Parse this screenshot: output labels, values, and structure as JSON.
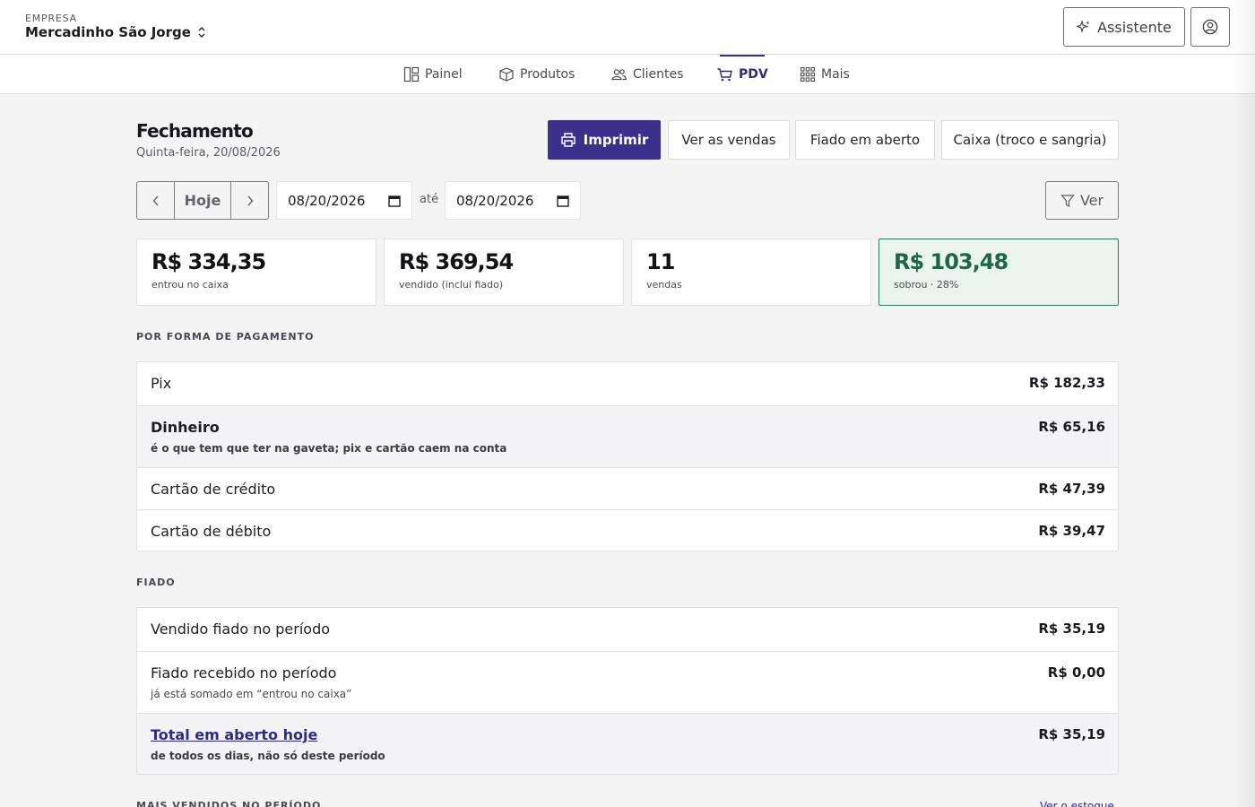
{
  "header": {
    "company_label": "EMPRESA",
    "company_name": "Mercadinho São Jorge",
    "assistant_label": "Assistente"
  },
  "nav": {
    "items": [
      {
        "label": "Painel",
        "icon": "layout-icon"
      },
      {
        "label": "Produtos",
        "icon": "box-icon"
      },
      {
        "label": "Clientes",
        "icon": "users-icon"
      },
      {
        "label": "PDV",
        "icon": "cart-icon",
        "active": true
      },
      {
        "label": "Mais",
        "icon": "grid-icon"
      }
    ]
  },
  "page": {
    "title": "Fechamento",
    "date": "Quinta-feira, 20/08/2026"
  },
  "actions": {
    "print": "Imprimir",
    "view_sales": "Ver as vendas",
    "open_credit": "Fiado em aberto",
    "cashbox": "Caixa (troco e sangria)"
  },
  "filters": {
    "today": "Hoje",
    "date_from": "08/20/2026",
    "until": "até",
    "date_to": "08/20/2026",
    "view": "Ver"
  },
  "stats": [
    {
      "value": "R$ 334,35",
      "label": "entrou no caixa"
    },
    {
      "value": "R$ 369,54",
      "label": "vendido (inclui fiado)"
    },
    {
      "value": "11",
      "label": "vendas"
    },
    {
      "value": "R$ 103,48",
      "label": "sobrou · 28%"
    }
  ],
  "payment_section": {
    "label": "POR FORMA DE PAGAMENTO",
    "rows": [
      {
        "label": "Pix",
        "value": "R$ 182,33"
      },
      {
        "label": "Dinheiro",
        "sub": "é o que tem que ter na gaveta; pix e cartão caem na conta",
        "value": "R$ 65,16"
      },
      {
        "label": "Cartão de crédito",
        "value": "R$ 47,39"
      },
      {
        "label": "Cartão de débito",
        "value": "R$ 39,47"
      }
    ]
  },
  "credit_section": {
    "label": "FIADO",
    "rows": [
      {
        "label": "Vendido fiado no período",
        "value": "R$ 35,19"
      },
      {
        "label": "Fiado recebido no período",
        "sub": "já está somado em “entrou no caixa”",
        "value": "R$ 0,00"
      },
      {
        "label": "Total em aberto hoje",
        "sub": "de todos os dias, não só deste período",
        "value": "R$ 35,19"
      }
    ]
  },
  "bottom": {
    "label": "MAIS VENDIDOS NO PERÍODO",
    "link": "Ver o estoque"
  },
  "colors": {
    "primary": "#3d2f8c",
    "success_text": "#1d6646",
    "success_bg": "#e9f4ef",
    "success_border": "#2d7a5a"
  }
}
